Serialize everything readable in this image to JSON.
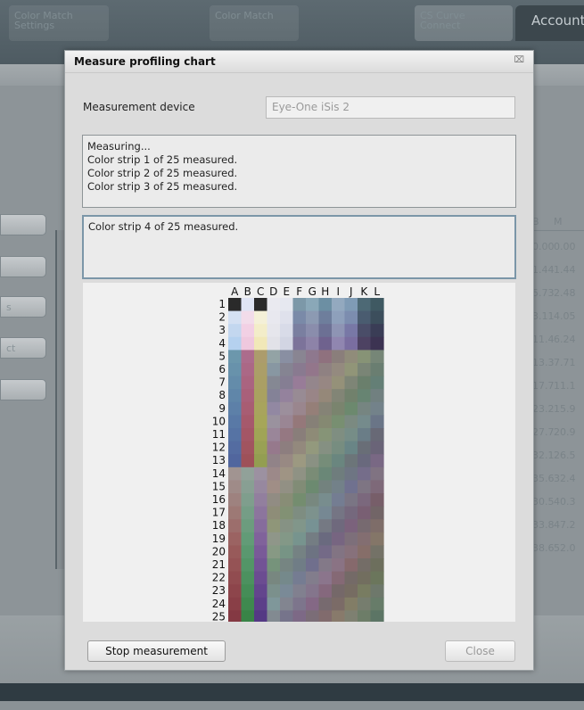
{
  "background": {
    "tabs": [
      "Color Match Settings",
      "Color Match",
      "CS Curve Connect"
    ],
    "account": "Account",
    "left_buttons": [
      "",
      "",
      "s",
      "ct",
      ""
    ],
    "table": {
      "headers": [
        "B",
        "M"
      ],
      "rows": [
        [
          "0.00",
          "0.00"
        ],
        [
          "1.44",
          "1.44"
        ],
        [
          "5.73",
          "2.48"
        ],
        [
          "3.11",
          "4.05"
        ],
        [
          "11.4",
          "6.24"
        ],
        [
          "13.3",
          "7.71"
        ],
        [
          "17.7",
          "11.1"
        ],
        [
          "23.2",
          "15.9"
        ],
        [
          "27.7",
          "20.9"
        ],
        [
          "32.1",
          "26.5"
        ],
        [
          "35.6",
          "32.4"
        ],
        [
          "30.5",
          "40.3"
        ],
        [
          "33.8",
          "47.2"
        ],
        [
          "38.6",
          "52.0"
        ]
      ]
    }
  },
  "dialog": {
    "title": "Measure profiling chart",
    "close_icon": "close-icon",
    "device_label": "Measurement device",
    "device_value": "Eye-One iSis 2",
    "log_lines": [
      "Measuring...",
      "Color strip 1 of 25 measured.",
      "Color strip 2 of 25 measured.",
      "Color strip 3 of 25 measured."
    ],
    "current_status": "Color strip 4 of 25 measured.",
    "stop_button": "Stop measurement",
    "close_button": "Close",
    "chart": {
      "column_labels": [
        "A",
        "B",
        "C",
        "D",
        "E",
        "F",
        "G",
        "H",
        "I",
        "J",
        "K",
        "L"
      ],
      "row_labels": [
        "1",
        "2",
        "3",
        "4",
        "5",
        "6",
        "7",
        "8",
        "9",
        "10",
        "11",
        "12",
        "13",
        "14",
        "15",
        "16",
        "17",
        "18",
        "19",
        "20",
        "21",
        "22",
        "23",
        "24",
        "25"
      ]
    }
  }
}
